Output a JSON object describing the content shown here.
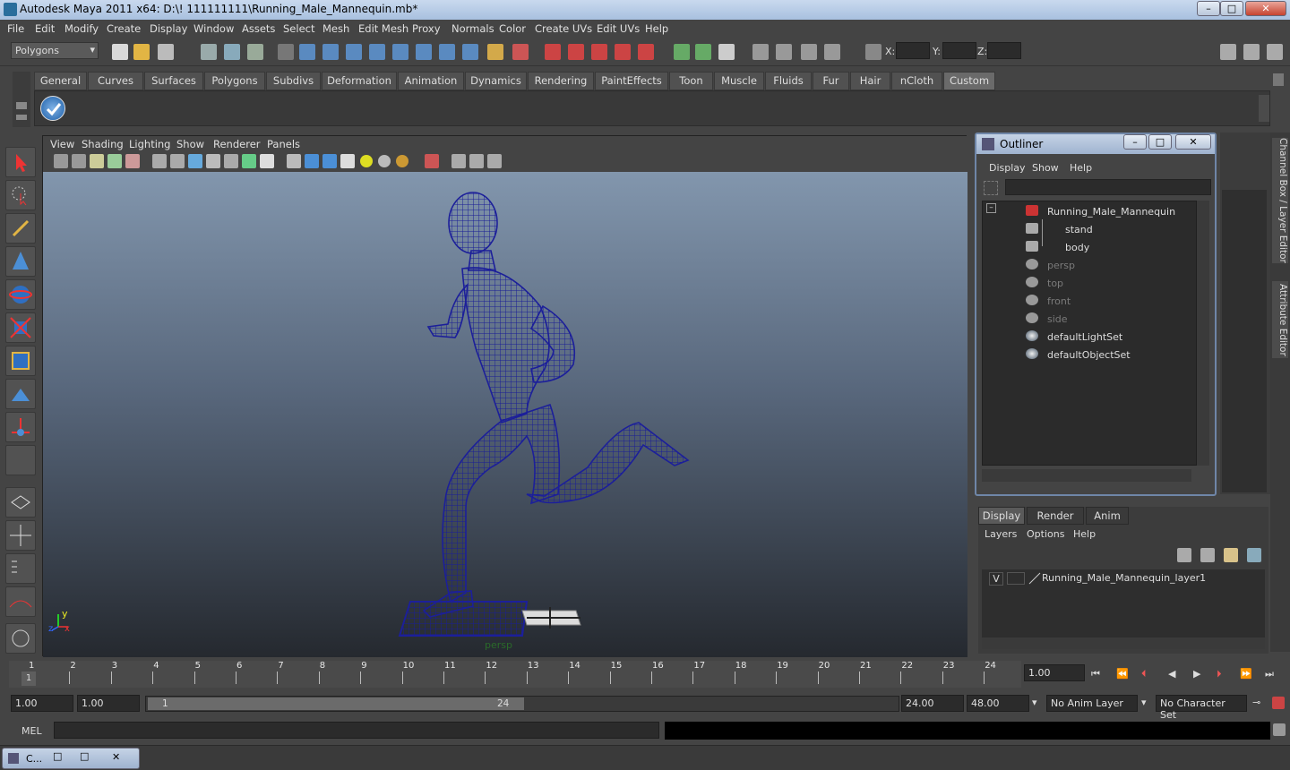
{
  "window": {
    "title": "Autodesk Maya 2011 x64: D:\\! 111111111\\Running_Male_Mannequin.mb*",
    "min": "–",
    "max": "□",
    "close": "✕"
  },
  "menubar": [
    "File",
    "Edit",
    "Modify",
    "Create",
    "Display",
    "Window",
    "Assets",
    "Select",
    "Mesh",
    "Edit Mesh",
    "Proxy",
    "Normals",
    "Color",
    "Create UVs",
    "Edit UVs",
    "Help"
  ],
  "toolbar": {
    "mode": "Polygons",
    "x_label": "X:",
    "y_label": "Y:",
    "z_label": "Z:"
  },
  "shelf_tabs": [
    "General",
    "Curves",
    "Surfaces",
    "Polygons",
    "Subdivs",
    "Deformation",
    "Animation",
    "Dynamics",
    "Rendering",
    "PaintEffects",
    "Toon",
    "Muscle",
    "Fluids",
    "Fur",
    "Hair",
    "nCloth",
    "Custom"
  ],
  "shelf_active": "Custom",
  "viewport": {
    "menu": [
      "View",
      "Shading",
      "Lighting",
      "Show",
      "Renderer",
      "Panels"
    ],
    "camera_label": "persp",
    "axis_y": "y",
    "axis_z": "z",
    "axis_x": "x"
  },
  "outliner": {
    "title": "Outliner",
    "menu": [
      "Display",
      "Show",
      "Help"
    ],
    "nodes": [
      {
        "name": "Running_Male_Mannequin",
        "dim": false
      },
      {
        "name": "stand",
        "dim": false
      },
      {
        "name": "body",
        "dim": false
      },
      {
        "name": "persp",
        "dim": true
      },
      {
        "name": "top",
        "dim": true
      },
      {
        "name": "front",
        "dim": true
      },
      {
        "name": "side",
        "dim": true
      },
      {
        "name": "defaultLightSet",
        "dim": false
      },
      {
        "name": "defaultObjectSet",
        "dim": false
      }
    ],
    "collapse": "–"
  },
  "right_tabs": {
    "channel": "Channel Box / Layer Editor",
    "attribute": "Attribute Editor"
  },
  "layer_editor": {
    "tabs": [
      "Display",
      "Render",
      "Anim"
    ],
    "menu": [
      "Layers",
      "Options",
      "Help"
    ],
    "layer_visibility": "V",
    "layer_name": "Running_Male_Mannequin_layer1"
  },
  "timeline": {
    "frames": [
      "1",
      "2",
      "3",
      "4",
      "5",
      "6",
      "7",
      "8",
      "9",
      "10",
      "11",
      "12",
      "13",
      "14",
      "15",
      "16",
      "17",
      "18",
      "19",
      "20",
      "21",
      "22",
      "23",
      "24"
    ],
    "current_frame_marker": "1",
    "current_time": "1.00"
  },
  "range": {
    "start": "1.00",
    "start2": "1.00",
    "slider_start": "1",
    "slider_end": "24",
    "end": "24.00",
    "end2": "48.00",
    "anim_layer": "No Anim Layer",
    "char_set": "No Character Set"
  },
  "cmd": {
    "label": "MEL"
  },
  "taskbar": {
    "item": "C..."
  }
}
